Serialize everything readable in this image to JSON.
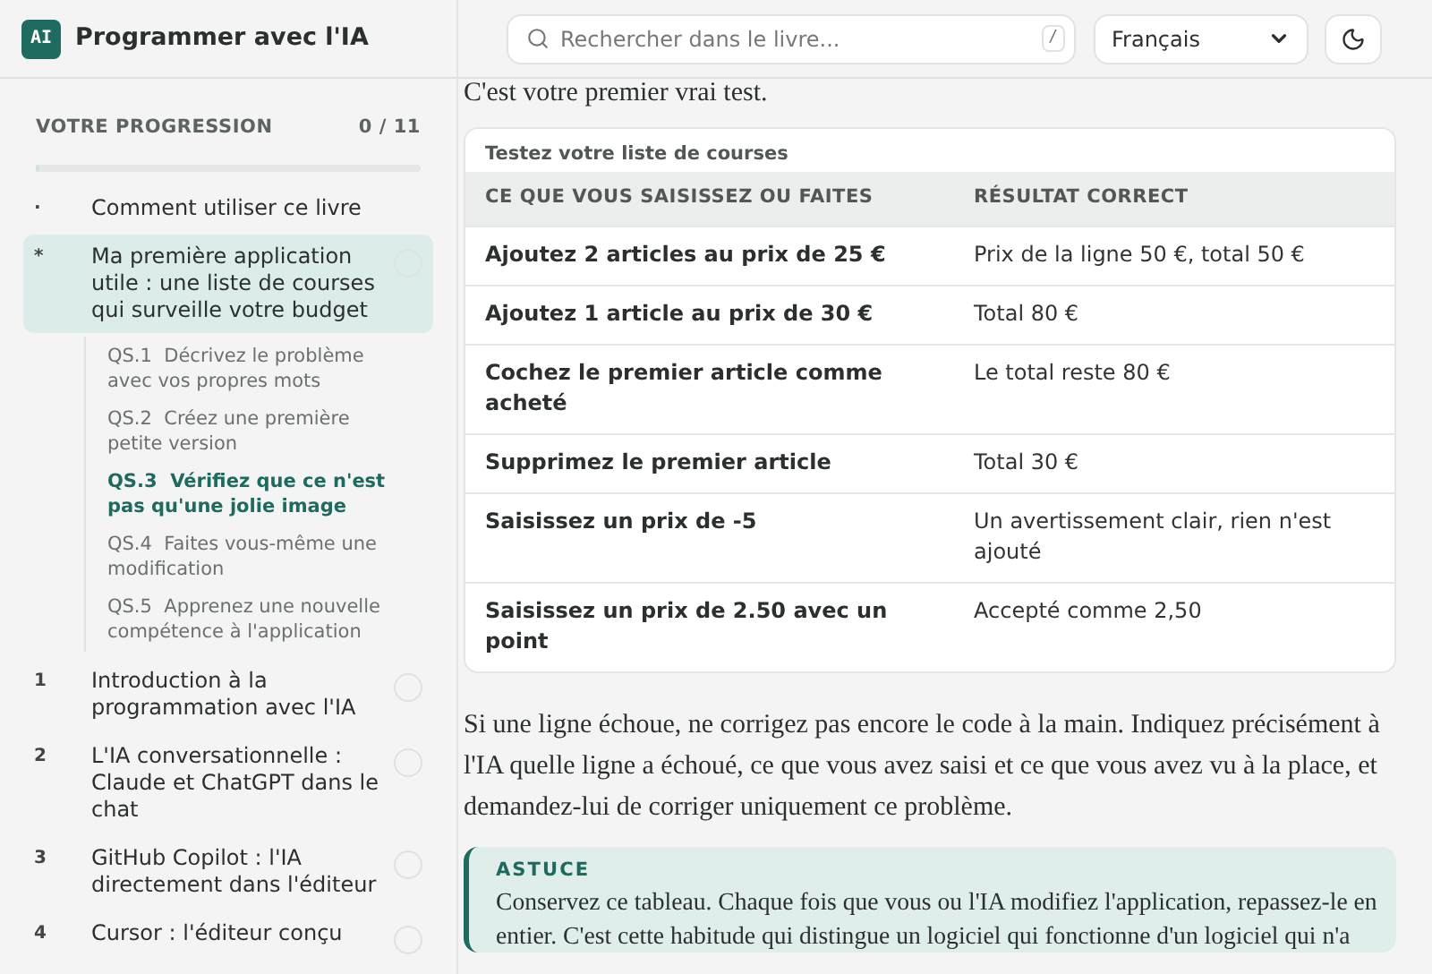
{
  "brand": {
    "logo": "AI",
    "title": "Programmer avec l'IA"
  },
  "progress": {
    "label": "VOTRE PROGRESSION",
    "count": "0 / 11",
    "level": 0
  },
  "nav": [
    {
      "marker": "·",
      "label": "Comment utiliser ce livre",
      "selected": false
    },
    {
      "marker": "*",
      "label": "Ma première application utile : une liste de courses qui surveille votre budget",
      "selected": true,
      "done": false,
      "children": [
        {
          "number": "QS.1",
          "label": "Décrivez le problème avec vos propres mots",
          "selected": false
        },
        {
          "number": "QS.2",
          "label": "Créez une première petite version",
          "selected": false
        },
        {
          "number": "QS.3",
          "label": "Vérifiez que ce n'est pas qu'une jolie image",
          "selected": true
        },
        {
          "number": "QS.4",
          "label": "Faites vous-même une modification",
          "selected": false
        },
        {
          "number": "QS.5",
          "label": "Apprenez une nouvelle compétence à l'application",
          "selected": false
        }
      ]
    },
    {
      "marker": "1",
      "label": "Introduction à la programmation avec l'IA",
      "selected": false,
      "done": false
    },
    {
      "marker": "2",
      "label": "L'IA conversationnelle : Claude et ChatGPT dans le chat",
      "selected": false,
      "done": false
    },
    {
      "marker": "3",
      "label": "GitHub Copilot : l'IA directement dans l'éditeur",
      "selected": false,
      "done": false
    },
    {
      "marker": "4",
      "label": "Cursor : l'éditeur conçu",
      "selected": false,
      "done": false
    }
  ],
  "search": {
    "placeholder": "Rechercher dans le livre...",
    "shortcut": "/"
  },
  "language": {
    "value": "Français"
  },
  "intro": "C'est votre premier vrai test.",
  "table": {
    "caption": "Testez votre liste de courses",
    "columns": [
      "CE QUE VOUS SAISISSEZ OU FAITES",
      "RÉSULTAT CORRECT"
    ],
    "rows": [
      [
        "Ajoutez 2 articles au prix de 25 €",
        "Prix de la ligne 50 €, total 50 €"
      ],
      [
        "Ajoutez 1 article au prix de 30 €",
        "Total 80 €"
      ],
      [
        "Cochez le premier article comme acheté",
        "Le total reste 80 €"
      ],
      [
        "Supprimez le premier article",
        "Total 30 €"
      ],
      [
        "Saisissez un prix de -5",
        "Un avertissement clair, rien n'est ajouté"
      ],
      [
        "Saisissez un prix de 2.50 avec un point",
        "Accepté comme 2,50"
      ]
    ]
  },
  "paragraph": "Si une ligne échoue, ne corrigez pas encore le code à la main. Indiquez précisément à l'IA quelle ligne a échoué, ce que vous avez saisi et ce que vous avez vu à la place, et demandez-lui de corriger uniquement ce problème.",
  "tip": {
    "title": "ASTUCE",
    "text": "Conservez ce tableau. Chaque fois que vous ou l'IA modifiez l'application, repassez-le en entier. C'est cette habitude qui distingue un logiciel qui fonctionne d'un logiciel qui n'a"
  }
}
